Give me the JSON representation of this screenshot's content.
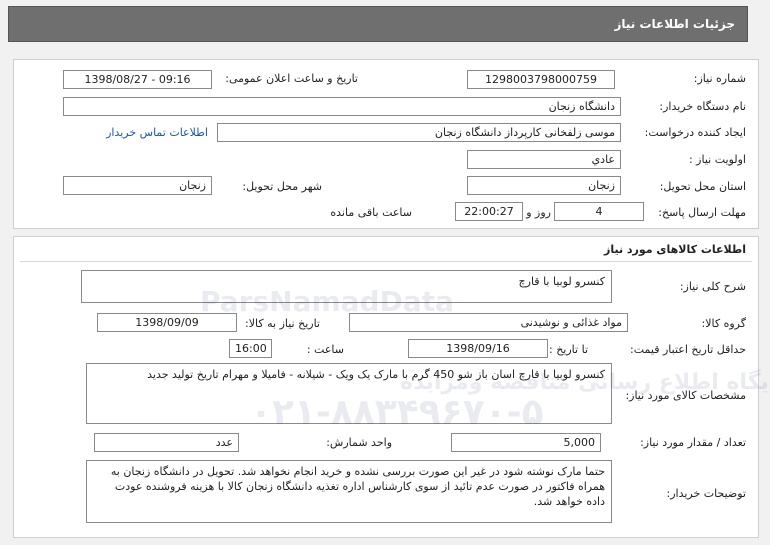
{
  "header": {
    "title": "جزئیات اطلاعات نیاز"
  },
  "need_info": {
    "need_number_label": "شماره نیاز:",
    "need_number": "1298003798000759",
    "announce_label": "تاریخ و ساعت اعلان عمومی:",
    "announce_value": "1398/08/27 - 09:16",
    "buyer_org_label": "نام دستگاه خریدار:",
    "buyer_org": "دانشگاه زنجان",
    "creator_label": "ایجاد کننده درخواست:",
    "creator": "موسی زلفخانی کارپرداز دانشگاه زنجان",
    "contact_link": "اطلاعات تماس خریدار",
    "priority_label": "اولویت نیاز :",
    "priority": "عادي",
    "province_label": "استان محل تحویل:",
    "province": "زنجان",
    "city_label": "شهر محل تحویل:",
    "city": "زنجان",
    "deadline_label": "مهلت ارسال پاسخ:",
    "deadline_days": "4",
    "days_and_label": "روز و",
    "deadline_time": "22:00:27",
    "remaining_label": "ساعت باقی مانده"
  },
  "goods": {
    "section_title": "اطلاعات کالاهای مورد نیاز",
    "summary_label": "شرح کلی نیاز:",
    "summary": "کنسرو لوبیا با قارچ",
    "group_label": "گروه کالا:",
    "group": "مواد غذائی و نوشیدنی",
    "need_date_label": "تاریخ نیاز به کالا:",
    "need_date": "1398/09/09",
    "validity_label": "حداقل تاریخ اعتبار قیمت:",
    "until_date_label": "تا تاریخ :",
    "validity_date": "1398/09/16",
    "time_label": "ساعت :",
    "validity_time": "16:00",
    "specs_label": "مشخصات کالای مورد نیاز:",
    "specs": "کنسرو لوبیا با قارچ اسان باز شو 450 گرم با مارک یک ویک - شیلانه - فامیلا و مهرام تاریخ تولید جدید",
    "quantity_label": "تعداد / مقدار مورد نیاز:",
    "quantity": "5,000",
    "unit_label": "واحد شمارش:",
    "unit": "عدد",
    "buyer_notes_label": "توضیحات خریدار:",
    "buyer_notes": "حتما مارک نوشته شود در غیر این صورت بررسی نشده و خرید انجام نخواهد شد. تحویل در دانشگاه زنجان به همراه فاکتور در صورت عدم تائید از سوی کارشناس اداره تغذیه دانشگاه زنجان کالا با هزینه فروشنده عودت داده خواهد شد."
  },
  "watermark": {
    "brand": "ParsNamadData",
    "line1": "پایگاه اطلاع رسانی مناقصه ومزایده",
    "phone": "۰۲۱-۸۸۳۴۹۶۷۰-۵"
  }
}
